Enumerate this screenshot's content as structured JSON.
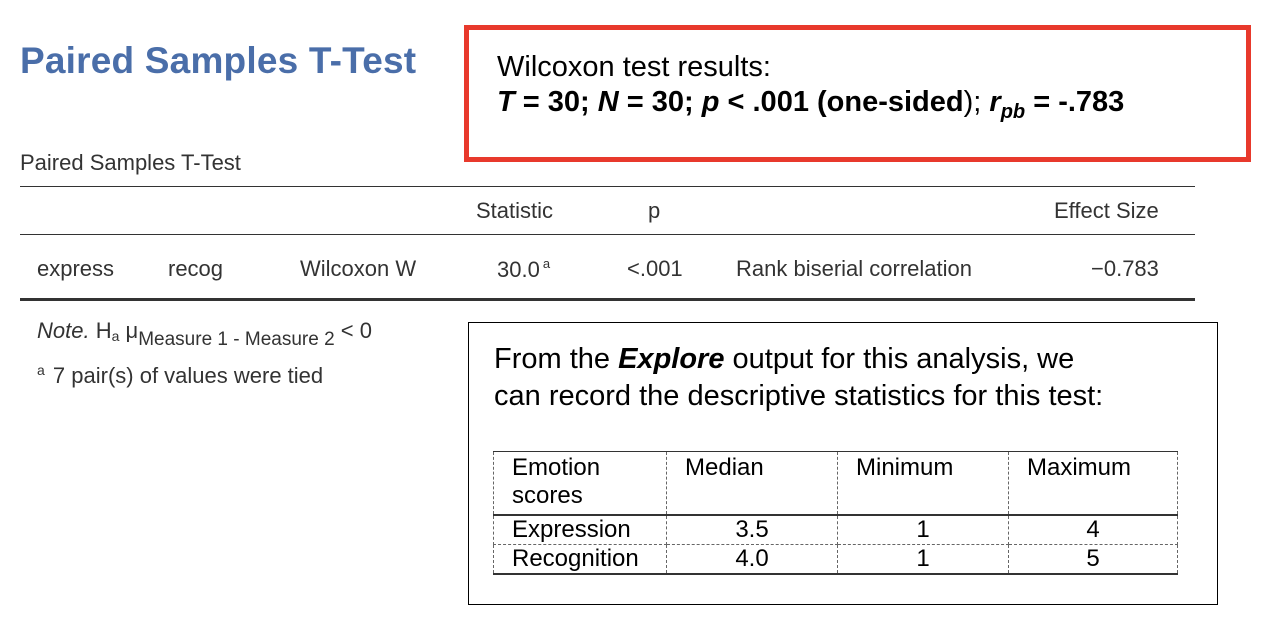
{
  "page_title": "Paired Samples T-Test",
  "table": {
    "caption": "Paired Samples T-Test",
    "headers": {
      "statistic": "Statistic",
      "p": "p",
      "effect_size": "Effect Size"
    },
    "row": {
      "measure1": "express",
      "measure2": "recog",
      "test": "Wilcoxon W",
      "statistic": "30.0",
      "statistic_footnote": "a",
      "p": "<.001",
      "effect_label": "Rank biserial correlation",
      "effect_value": "−0.783"
    },
    "note": {
      "prefix": "Note.",
      "h": "H",
      "h_sub": "a",
      "mu": "μ",
      "measures": "Measure 1 - Measure 2",
      "relation": "< 0",
      "footnote_marker": "a",
      "footnote_text": "7 pair(s) of values were tied"
    }
  },
  "results_box": {
    "line1": "Wilcoxon test results:",
    "T_label": "T",
    "T_value": " = 30; ",
    "N_label": "N",
    "N_value": " = 30; ",
    "p_label": "p",
    "p_value": " < .001 (one-sided",
    "close": "); ",
    "r_label": "r",
    "r_sub": "pb",
    "r_value": " = -.783"
  },
  "explore_box": {
    "line1_pre": "From the ",
    "line1_em": "Explore",
    "line1_post": " output for this analysis, we",
    "line2": "can record the descriptive statistics for this test:",
    "table": {
      "headers": [
        "Emotion scores",
        "Median",
        "Minimum",
        "Maximum"
      ],
      "rows": [
        [
          "Expression",
          "3.5",
          "1",
          "4"
        ],
        [
          "Recognition",
          "4.0",
          "1",
          "5"
        ]
      ]
    }
  },
  "colors": {
    "title_blue": "#4a6ea9",
    "box_red": "#e8392c"
  }
}
